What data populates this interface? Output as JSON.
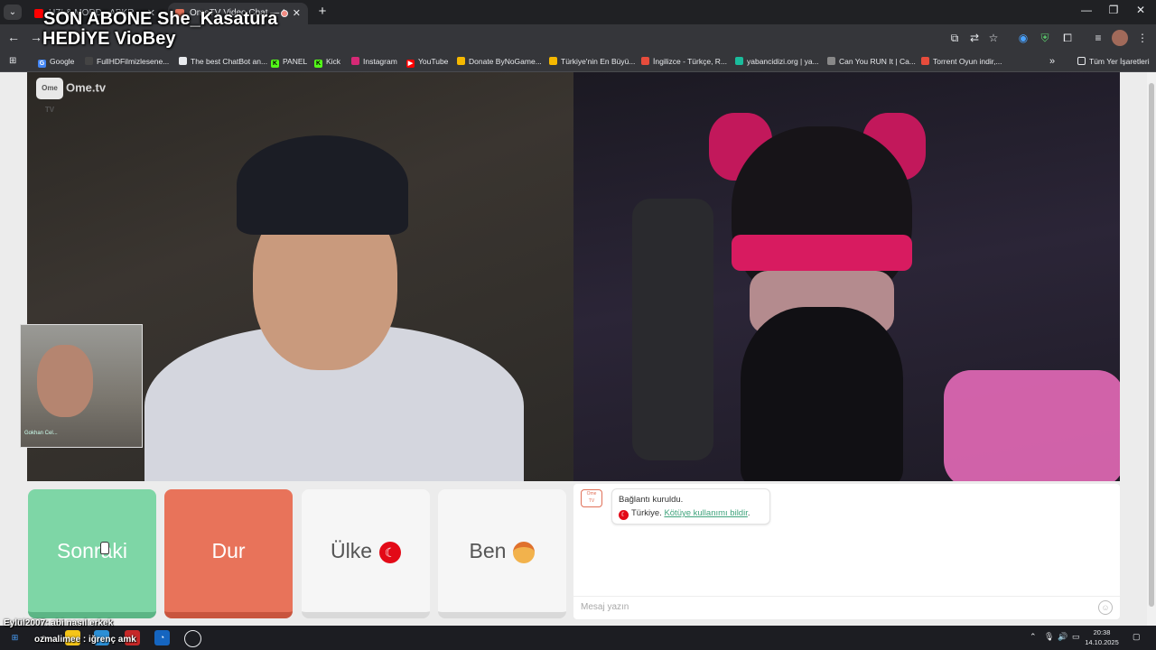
{
  "browser": {
    "tabs": [
      {
        "title": "UZI & MODD - ABKR - YouTube",
        "active": false,
        "favicon_color": "#ff0000"
      },
      {
        "title": "OmeTV Video Chat — Ome",
        "active": true,
        "favicon_color": "#e07058"
      }
    ],
    "bookmarks": [
      {
        "label": "Google",
        "color": "#4285f4"
      },
      {
        "label": "FullHDFilmizlesene...",
        "color": "#444444"
      },
      {
        "label": "The best ChatBot an...",
        "color": "#e8eaed"
      },
      {
        "label": "PANEL",
        "color": "#53fc18"
      },
      {
        "label": "Kick",
        "color": "#53fc18"
      },
      {
        "label": "Instagram",
        "color": "#d62976"
      },
      {
        "label": "YouTube",
        "color": "#ff0000"
      },
      {
        "label": "Donate ByNoGame...",
        "color": "#f5b800"
      },
      {
        "label": "Türkiye'nin En Büyü...",
        "color": "#f5b800"
      },
      {
        "label": "İngilizce - Türkçe, R...",
        "color": "#e74c3c"
      },
      {
        "label": "yabancidizi.org | ya...",
        "color": "#1abc9c"
      },
      {
        "label": "Can You RUN It | Ca...",
        "color": "#888888"
      },
      {
        "label": "Torrent Oyun indir,...",
        "color": "#e74c3c"
      }
    ],
    "all_bookmarks": "Tüm Yer İşaretleri"
  },
  "overlay": {
    "line1": "SON ABONE She_Kasatura",
    "line2": "HEDİYE VioBey",
    "bottom_left": "Eylül2007: abi nasıl erkek",
    "bottom_chat": "ozmalimee : iğrenç amk"
  },
  "ometv": {
    "logo": "Ome.tv",
    "pip_label": "Gokhan Cel...",
    "buttons": {
      "next": "Sonraki",
      "stop": "Dur",
      "country": "Ülke",
      "me": "Ben"
    },
    "chat": {
      "connected": "Bağlantı kuruldu.",
      "country": "Türkiye.",
      "report": "Kötüye kullanımı bildir",
      "placeholder": "Mesaj yazın"
    }
  },
  "taskbar": {
    "time": "20:38",
    "date": "14.10.2025"
  }
}
